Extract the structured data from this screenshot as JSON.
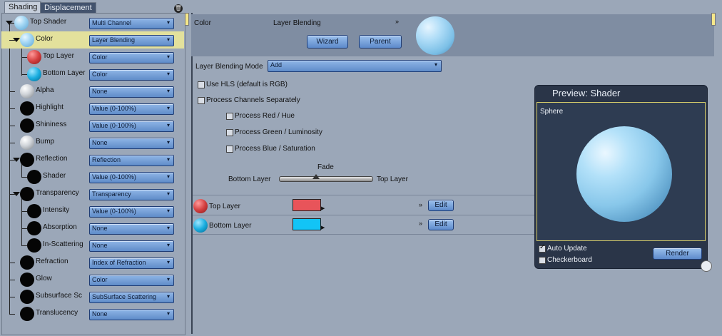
{
  "tabs": [
    "Shading",
    "Displacement"
  ],
  "tree": [
    {
      "label": "Top Shader",
      "value": "Multi Channel",
      "ball": "blue"
    },
    {
      "label": "Color",
      "value": "Layer Blending",
      "ball": "blue"
    },
    {
      "label": "Top Layer",
      "value": "Color",
      "ball": "red"
    },
    {
      "label": "Bottom Layer",
      "value": "Color",
      "ball": "cyan"
    },
    {
      "label": "Alpha",
      "value": "None",
      "ball": "gray"
    },
    {
      "label": "Highlight",
      "value": "Value (0-100%)",
      "ball": "black"
    },
    {
      "label": "Shininess",
      "value": "Value (0-100%)",
      "ball": "black"
    },
    {
      "label": "Bump",
      "value": "None",
      "ball": "gray"
    },
    {
      "label": "Reflection",
      "value": "Reflection",
      "ball": "black"
    },
    {
      "label": "Shader",
      "value": "Value (0-100%)",
      "ball": "black"
    },
    {
      "label": "Transparency",
      "value": "Transparency",
      "ball": "black"
    },
    {
      "label": "Intensity",
      "value": "Value (0-100%)",
      "ball": "black"
    },
    {
      "label": "Absorption",
      "value": "None",
      "ball": "black"
    },
    {
      "label": "In-Scattering",
      "value": "None",
      "ball": "black"
    },
    {
      "label": "Refraction",
      "value": "Index of Refraction",
      "ball": "black"
    },
    {
      "label": "Glow",
      "value": "Color",
      "ball": "black"
    },
    {
      "label": "Subsurface Sc",
      "value": "SubSurface Scattering",
      "ball": "black"
    },
    {
      "label": "Translucency",
      "value": "None",
      "ball": "black"
    }
  ],
  "header": {
    "channel": "Color",
    "shader": "Layer Blending",
    "wizard": "Wizard",
    "parent": "Parent"
  },
  "blend": {
    "mode_label": "Layer Blending Mode",
    "mode_value": "Add",
    "use_hls": "Use HLS (default is RGB)",
    "process_sep": "Process Channels Separately",
    "red": "Process Red / Hue",
    "green": "Process Green / Luminosity",
    "blue": "Process Blue / Saturation",
    "fade": "Fade",
    "bottom": "Bottom Layer",
    "top": "Top Layer"
  },
  "layers": [
    {
      "label": "Top Layer",
      "swatch": "#e8545a",
      "edit": "Edit"
    },
    {
      "label": "Bottom Layer",
      "swatch": "#12c4f6",
      "edit": "Edit"
    }
  ],
  "preview": {
    "title": "Preview: Shader",
    "object": "Sphere",
    "auto_update": "Auto Update",
    "checkerboard": "Checkerboard",
    "render": "Render"
  }
}
